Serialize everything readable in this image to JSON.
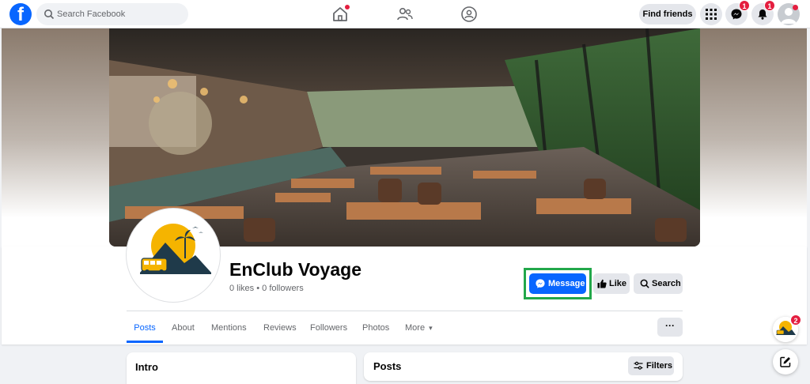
{
  "nav": {
    "logo": "f",
    "search_placeholder": "Search Facebook",
    "find_friends": "Find friends",
    "messenger_badge": "1",
    "notifications_badge": "1"
  },
  "page": {
    "name": "EnClub Voyage",
    "stats": "0 likes • 0 followers"
  },
  "actions": {
    "message": "Message",
    "like": "Like",
    "search": "Search"
  },
  "tabs": [
    "Posts",
    "About",
    "Mentions",
    "Reviews",
    "Followers",
    "Photos",
    "More"
  ],
  "tab_more_suffix": "▾",
  "more_dots": "···",
  "intro_title": "Intro",
  "posts_title": "Posts",
  "filters_label": "Filters",
  "chat_badge": "2",
  "colors": {
    "brand": "#0866ff",
    "highlight": "#22a74a",
    "badge": "#e41e3f"
  }
}
